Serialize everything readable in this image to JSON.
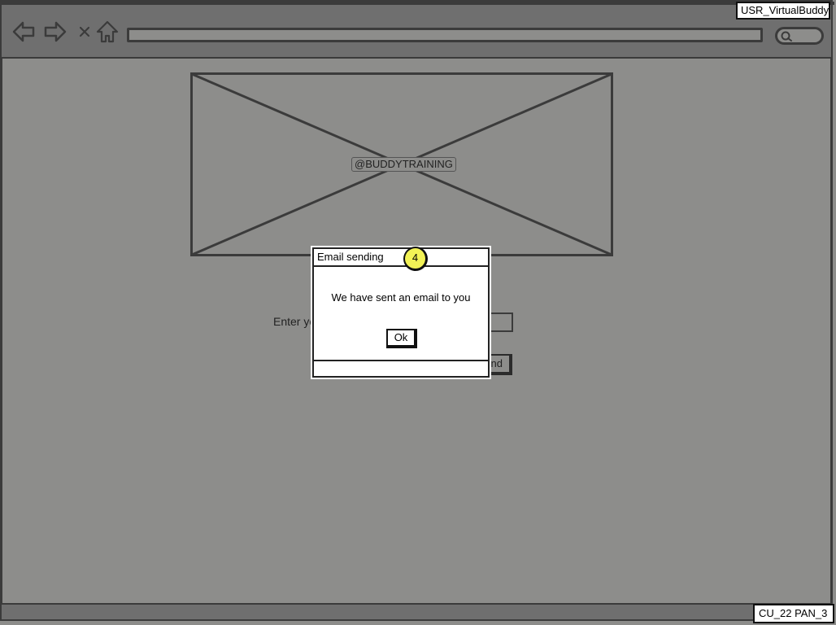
{
  "app_label": "USR_VirtualBuddy",
  "screen_id": "CU_22 PAN_3",
  "browser": {
    "back_icon": "arrow-left-icon",
    "forward_icon": "arrow-right-icon",
    "close_icon": "x-icon",
    "home_icon": "home-icon",
    "search_icon": "magnifier-icon"
  },
  "main": {
    "image_caption": "@BUDDYTRAINING",
    "email_prompt": "Enter yo",
    "send_label": "Send"
  },
  "dialog": {
    "title": "Email sending",
    "message": "We have sent an email to you",
    "ok_label": "Ok",
    "callout_number": "4"
  },
  "colors": {
    "background": "#8d8d8b",
    "chrome": "#6f6f6f",
    "outline": "#3b3b3b",
    "callout": "#f2f256"
  }
}
